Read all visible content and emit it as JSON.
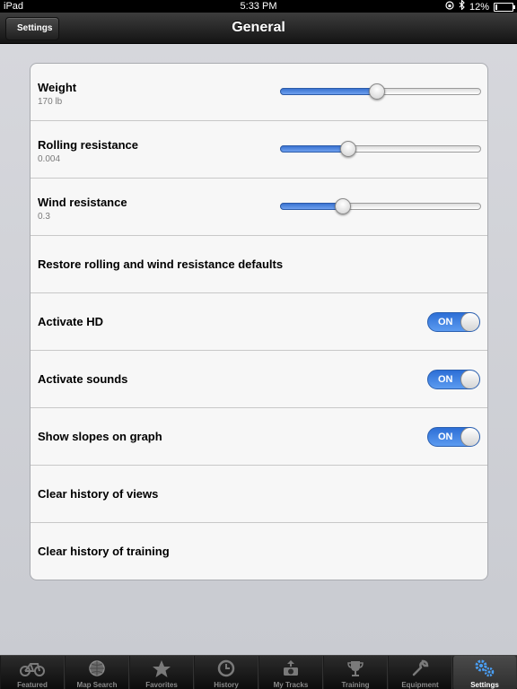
{
  "status_bar": {
    "device": "iPad",
    "time": "5:33 PM",
    "battery": "12%",
    "battery_level": 0.12
  },
  "nav": {
    "title": "General",
    "back_label": "Settings"
  },
  "rows": {
    "weight": {
      "label": "Weight",
      "value": "170 lb",
      "level": 0.48
    },
    "rolling": {
      "label": "Rolling resistance",
      "value": "0.004",
      "level": 0.34
    },
    "wind": {
      "label": "Wind resistance",
      "value": "0.3",
      "level": 0.31
    },
    "restore": {
      "label": "Restore rolling and wind resistance defaults"
    },
    "hd": {
      "label": "Activate HD",
      "toggle": "ON"
    },
    "sounds": {
      "label": "Activate sounds",
      "toggle": "ON"
    },
    "slopes": {
      "label": "Show slopes on graph",
      "toggle": "ON"
    },
    "clear_views": {
      "label": "Clear history of views"
    },
    "clear_training": {
      "label": "Clear history of training"
    }
  },
  "tabs": [
    {
      "label": "Featured",
      "icon": "bike-icon"
    },
    {
      "label": "Map Search",
      "icon": "globe-icon"
    },
    {
      "label": "Favorites",
      "icon": "star-icon"
    },
    {
      "label": "History",
      "icon": "clock-icon"
    },
    {
      "label": "My Tracks",
      "icon": "camera-icon"
    },
    {
      "label": "Training",
      "icon": "trophy-icon"
    },
    {
      "label": "Equipment",
      "icon": "wrench-icon"
    },
    {
      "label": "Settings",
      "icon": "gears-icon",
      "active": true
    }
  ],
  "colors": {
    "accent": "#2d6fd6",
    "active_tab_icon": "#4a9ff5"
  }
}
